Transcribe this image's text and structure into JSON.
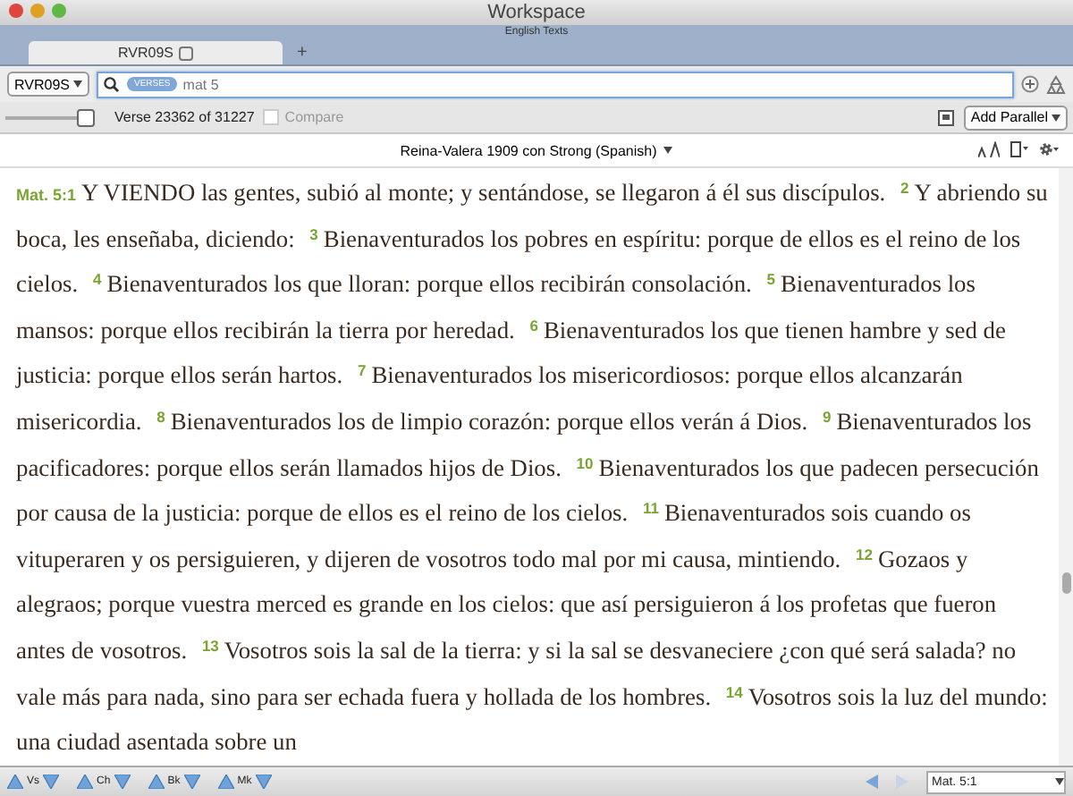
{
  "window": {
    "title": "Workspace"
  },
  "workspace_label": "English Texts",
  "tabs": [
    {
      "label": "RVR09S",
      "selected": true
    }
  ],
  "new_tab": "+",
  "search": {
    "module": "RVR09S",
    "scope": "VERSES",
    "value": "mat 5"
  },
  "toolbar": {
    "position": "Verse 23362 of 31227",
    "compare": {
      "label": "Compare",
      "checked": false,
      "disabled": true
    },
    "add_parallel": "Add Parallel",
    "font_slider": {
      "level": 1.0
    }
  },
  "version_title": "Reina-Valera 1909 con Strong (Spanish)",
  "verses": [
    {
      "number": "Mat. 5:1",
      "text": "Y VIENDO las gentes, subió al monte; y sentándose, se llegaron á él sus discípulos."
    },
    {
      "number": "2",
      "text": "Y abriendo su boca, les enseñaba, diciendo:"
    },
    {
      "number": "3",
      "text": "Bienaventurados los pobres en espíritu: porque de ellos es el reino de los cielos."
    },
    {
      "number": "4",
      "text": "Bienaventurados los que lloran: porque ellos recibirán consolación."
    },
    {
      "number": "5",
      "text": "Bienaventurados los mansos: porque ellos recibirán la tierra por heredad."
    },
    {
      "number": "6",
      "text": "Bienaventurados los que tienen hambre y sed de justicia: porque ellos serán hartos."
    },
    {
      "number": "7",
      "text": "Bienaventurados los misericordiosos: porque ellos alcanzarán misericordia."
    },
    {
      "number": "8",
      "text": "Bienaventurados los de limpio corazón: porque ellos verán á Dios."
    },
    {
      "number": "9",
      "text": "Bienaventurados los pacificadores: porque ellos serán llamados hijos de Dios."
    },
    {
      "number": "10",
      "text": "Bienaventurados los que padecen persecución por causa de la justicia: porque de ellos es el reino de los cielos."
    },
    {
      "number": "11",
      "text": "Bienaventurados sois cuando os vituperaren y os persiguieren, y dijeren de vosotros todo mal por mi causa, mintiendo."
    },
    {
      "number": "12",
      "text": "Gozaos y alegraos; porque vuestra merced es grande en los cielos: que así persiguieron á los profetas que fueron antes de vosotros."
    },
    {
      "number": "13",
      "text": "Vosotros sois la sal de la tierra: y si la sal se desvaneciere ¿con qué será salada? no vale más para nada, sino para ser echada fuera y hollada de los hombres."
    },
    {
      "number": "14",
      "text": "Vosotros sois la luz del mundo: una ciudad asentada sobre un"
    }
  ],
  "navigation": [
    {
      "label": "Vs"
    },
    {
      "label": "Ch"
    },
    {
      "label": "Bk"
    },
    {
      "label": "Mk"
    }
  ],
  "reference": "Mat. 5:1"
}
